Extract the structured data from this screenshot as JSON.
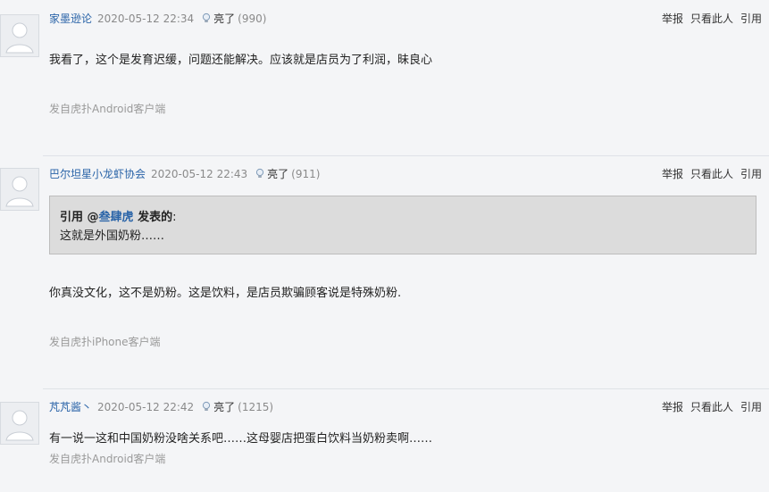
{
  "posts": [
    {
      "author": "家墨逊论",
      "time": "2020-05-12 22:34",
      "light_label": "亮了",
      "light_count": "(990)",
      "actions": [
        "举报",
        "只看此人",
        "引用"
      ],
      "content": "我看了，这个是发育迟缓，问题还能解决。应该就是店员为了利润，昧良心",
      "source": "发自虎扑Android客户端"
    },
    {
      "author": "巴尔坦星小龙虾协会",
      "time": "2020-05-12 22:43",
      "light_label": "亮了",
      "light_count": "(911)",
      "actions": [
        "举报",
        "只看此人",
        "引用"
      ],
      "quote": {
        "prefix": "引用 @",
        "user": "叁肆虎",
        "suffix": " 发表的",
        "colon": ":",
        "text": "这就是外国奶粉……"
      },
      "content": "你真没文化，这不是奶粉。这是饮料，是店员欺骗顾客说是特殊奶粉.",
      "source": "发自虎扑iPhone客户端"
    },
    {
      "author": "芃芃酱丶",
      "time": "2020-05-12 22:42",
      "light_label": "亮了",
      "light_count": "(1215)",
      "actions": [
        "举报",
        "只看此人",
        "引用"
      ],
      "content": "有一说一这和中国奶粉没啥关系吧……这母婴店把蛋白饮料当奶粉卖啊……",
      "source": "发自虎扑Android客户端"
    }
  ],
  "icons": {
    "avatar": "default-avatar-icon",
    "light": "lightbulb-icon"
  },
  "colors": {
    "author_link": "#2a64a8",
    "background": "#f4f5f7",
    "quote_bg": "#dcdcdc",
    "muted_text": "#9a9a9a"
  }
}
